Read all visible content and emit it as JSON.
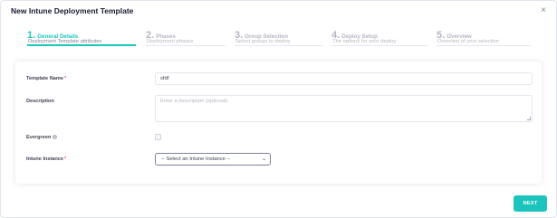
{
  "modal": {
    "title": "New Intune Deployment Template",
    "close_symbol": "×"
  },
  "stepper": {
    "steps": [
      {
        "number": "1.",
        "title": "General Details",
        "description": "Deployment Template attributes",
        "active": true
      },
      {
        "number": "2.",
        "title": "Phases",
        "description": "Deployment phases",
        "active": false
      },
      {
        "number": "3.",
        "title": "Group Selection",
        "description": "Select groups to deploy",
        "active": false
      },
      {
        "number": "4.",
        "title": "Deploy Setup",
        "description": "The options for your deploy",
        "active": false
      },
      {
        "number": "5.",
        "title": "Overview",
        "description": "Overview of your selection",
        "active": false
      }
    ]
  },
  "form": {
    "template_name": {
      "label": "Template Name",
      "required_mark": "*",
      "value": "sfdf"
    },
    "description": {
      "label": "Description",
      "placeholder": "Enter a description (optional)"
    },
    "evergreen": {
      "label": "Evergreen",
      "info_glyph": "i",
      "checked": false
    },
    "intune_instance": {
      "label": "Intune Instance",
      "required_mark": "*",
      "selected": "-- Select an Intune Instance --",
      "chevron": "⌄"
    }
  },
  "footer": {
    "next_label": "NEXT"
  },
  "colors": {
    "accent": "#1bc5bd",
    "required": "#f64e60",
    "muted": "#b5b5c3"
  }
}
